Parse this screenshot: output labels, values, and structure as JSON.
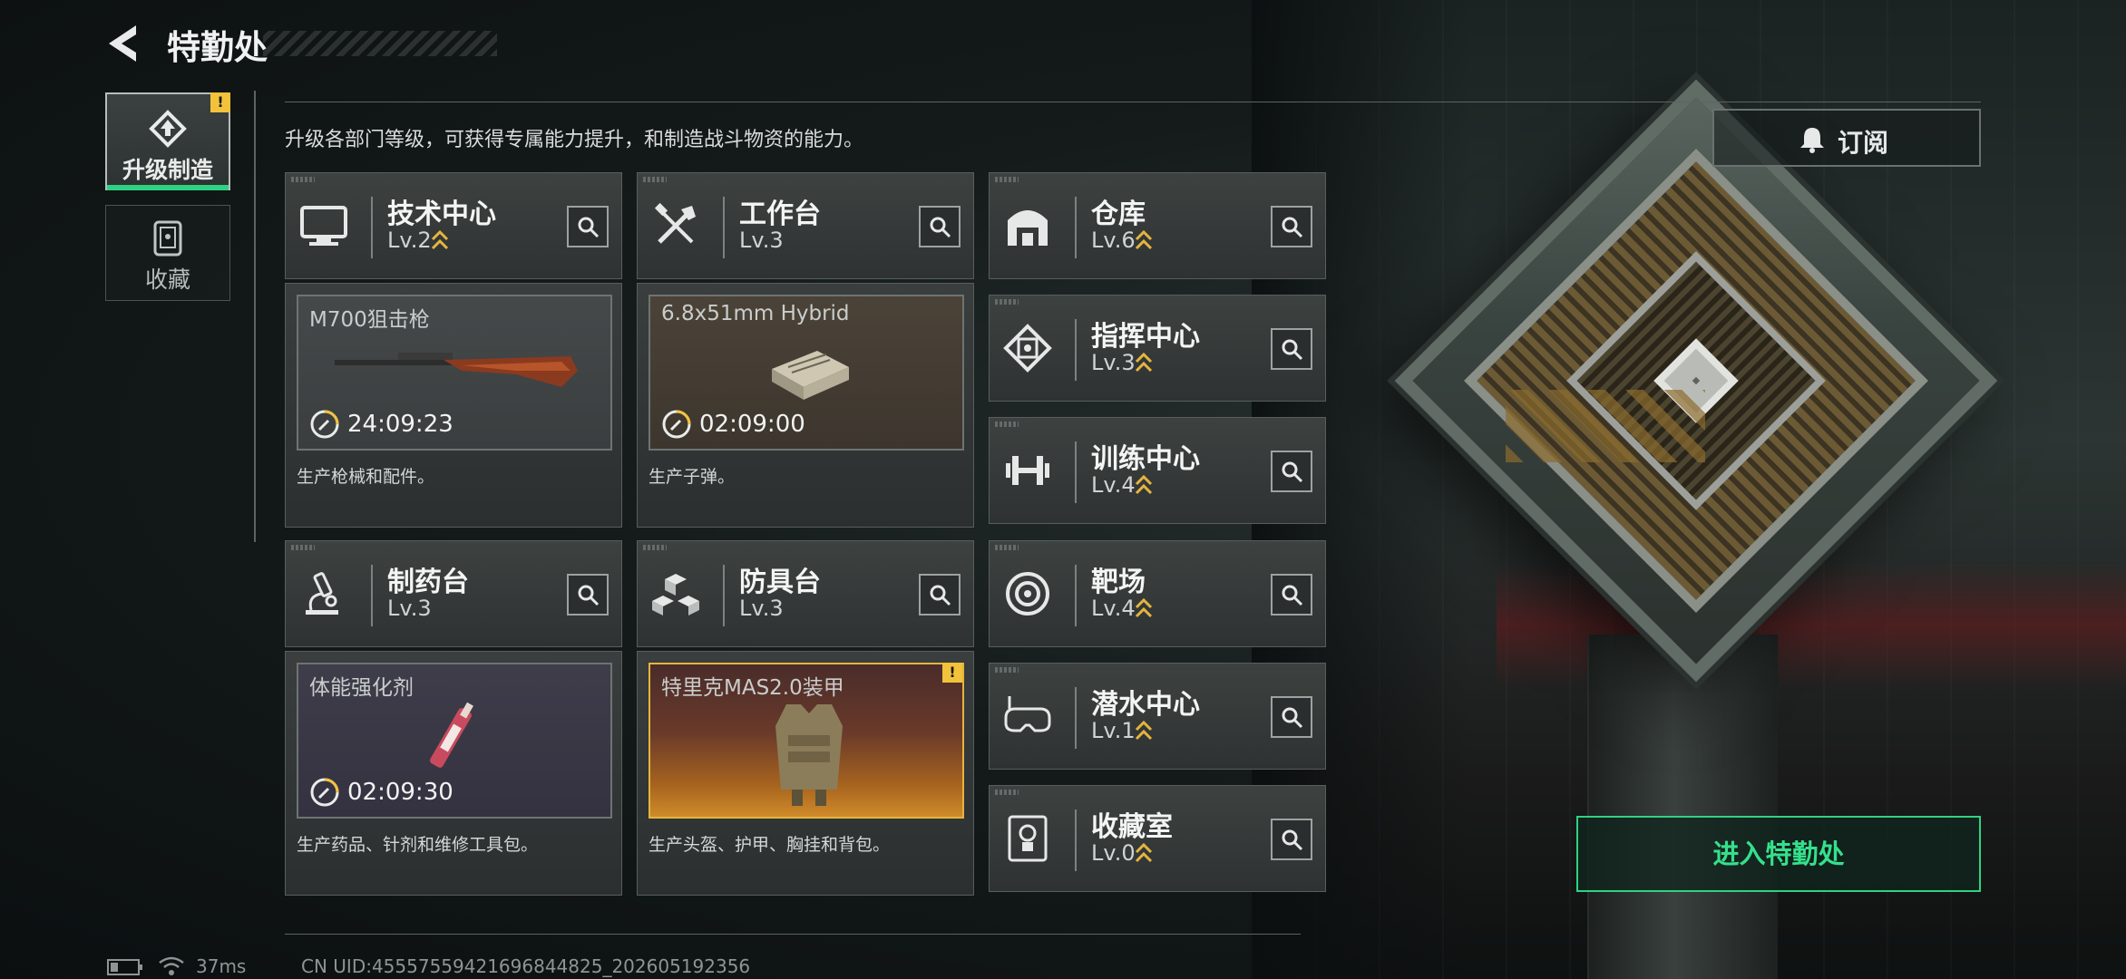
{
  "header": {
    "title": "特勤处"
  },
  "sidebar": {
    "tabs": [
      {
        "label": "升级制造",
        "active": true,
        "badge": "!"
      },
      {
        "label": "收藏",
        "active": false
      }
    ]
  },
  "intro": "升级各部门等级，可获得专属能力提升，和制造战斗物资的能力。",
  "departments": [
    {
      "name": "技术中心",
      "level": "Lv.2",
      "upgradable": true
    },
    {
      "name": "工作台",
      "level": "Lv.3",
      "upgradable": false
    },
    {
      "name": "仓库",
      "level": "Lv.6",
      "upgradable": true
    },
    {
      "name": "指挥中心",
      "level": "Lv.3",
      "upgradable": true
    },
    {
      "name": "训练中心",
      "level": "Lv.4",
      "upgradable": true
    },
    {
      "name": "制药台",
      "level": "Lv.3",
      "upgradable": false
    },
    {
      "name": "防具台",
      "level": "Lv.3",
      "upgradable": false
    },
    {
      "name": "靶场",
      "level": "Lv.4",
      "upgradable": true
    },
    {
      "name": "潜水中心",
      "level": "Lv.1",
      "upgradable": true
    },
    {
      "name": "收藏室",
      "level": "Lv.0",
      "upgradable": true
    }
  ],
  "productions": [
    {
      "item": "M700狙击枪",
      "timer": "24:09:23",
      "desc": "生产枪械和配件。"
    },
    {
      "item": "6.8x51mm Hybrid",
      "timer": "02:09:00",
      "desc": "生产子弹。"
    },
    {
      "item": "体能强化剂",
      "timer": "02:09:30",
      "desc": "生产药品、针剂和维修工具包。"
    },
    {
      "item": "特里克MAS2.0装甲",
      "timer": "",
      "desc": "生产头盔、护甲、胸挂和背包。",
      "badge": "!"
    }
  ],
  "actions": {
    "subscribe": "订阅",
    "enter": "进入特勤处"
  },
  "status": {
    "ping": "37ms",
    "uid": "CN UID:4555755942169684482​5_202605192356"
  },
  "colors": {
    "accent": "#2fd283",
    "warning": "#f2c23b",
    "upgrade": "#e5b53e"
  }
}
